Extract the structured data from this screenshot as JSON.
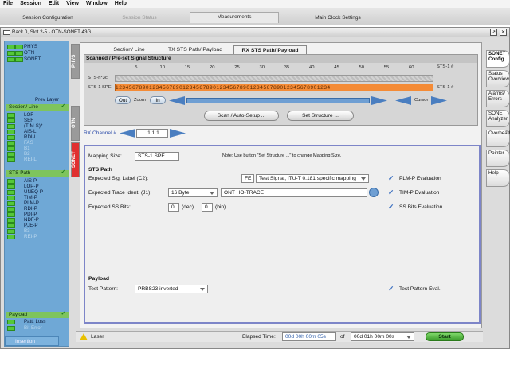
{
  "menu": {
    "file": "File",
    "session": "Session",
    "edit": "Edit",
    "view": "View",
    "window": "Window",
    "help": "Help"
  },
  "tabs": {
    "session_config": "Session Configuration",
    "session_status": "Session Status",
    "measurements": "Measurements",
    "main_clock": "Main Clock Settings"
  },
  "window": {
    "title": "Rack 0, Slot 2-5 - OTN-SONET 43G",
    "restore": "↗",
    "close": "✕"
  },
  "leftpane": {
    "phys": "PHYS",
    "otn": "OTN",
    "sonet": "SONET",
    "prev_layer": "Prev Layer",
    "section_line": "Section/ Line",
    "section_items": [
      "LOF",
      "SEF",
      "(TIM-S)*",
      "AIS-L",
      "RDI-L",
      "FAS",
      "B1",
      "B2",
      "REI-L"
    ],
    "sts_path": "STS Path",
    "path_items": [
      "AIS-P",
      "LOP-P",
      "UNEQ-P",
      "TIM-P",
      "PLM-P",
      "RDI-P",
      "PDI-P",
      "NDF-P",
      "PJE-P",
      "B3",
      "REI-P"
    ],
    "payload": "Payload",
    "patt_loss": "Patt. Loss",
    "bit_error": "Bit Error",
    "insertion": "Insertion"
  },
  "sidetabs": {
    "phys": "PHYS",
    "otn": "OTN",
    "sonet": "SONET"
  },
  "subtabs": {
    "section_line": "Section/ Line",
    "tx_sts": "TX STS Path/ Payload",
    "rx_sts": "RX STS Path/ Payload"
  },
  "signal": {
    "header": "Scanned / Pre-set Signal Structure",
    "ticks": [
      "5",
      "10",
      "15",
      "20",
      "25",
      "30",
      "35",
      "40",
      "45",
      "50",
      "55",
      "60"
    ],
    "row1_label": "STS-n*3c",
    "row2_label": "STS-1 SPE",
    "row_tag": "STS-1 #",
    "row2_digits": "1234567890123456789012345678901234567890123456789012345678901234",
    "out": "Out",
    "zoom": "Zoom",
    "in": "In",
    "cursor": "Cursor"
  },
  "buttons": {
    "scan": "Scan / Auto-Setup ...",
    "set_structure": "Set Structure ...",
    "start": "Start"
  },
  "rx": {
    "label": "RX Channel #",
    "value": "1.1.1"
  },
  "mapping": {
    "label": "Mapping Size:",
    "value": "STS-1 SPE",
    "note": "Note: Use button \"Set Structure ...\" to change Mapping Size."
  },
  "sts_path": {
    "title": "STS Path",
    "sig_label": "Expected Sig. Label (C2):",
    "sig_code": "FE",
    "sig_value": "Test Signal, ITU-T 0.181 specific mapping",
    "trace_label": "Expected Trace Ident. (J1):",
    "trace_len": "16 Byte",
    "trace_value": "ONT HO-TRACE",
    "ss_label": "Expected SS Bits:",
    "ss_dec": "0",
    "ss_dec_unit": "(dec)",
    "ss_bin": "0",
    "ss_bin_unit": "(bin)",
    "plm": "PLM-P Evaluation",
    "tim": "TIM-P Evaluation",
    "ssbits": "SS Bits Evaluation"
  },
  "payload": {
    "title": "Payload",
    "pattern_label": "Test Pattern:",
    "pattern_value": "PRBS23 inverted",
    "pattern_eval": "Test Pattern Eval."
  },
  "righttabs": [
    "SONET Config.",
    "Status Overview",
    "Alarms/ Errors",
    "SONET Analyzer",
    "Overhead",
    "Pointer",
    "Help"
  ],
  "status": {
    "laser": "Laser",
    "elapsed_label": "Elapsed Time:",
    "elapsed": "00d 00h 00m 05s",
    "of": "of",
    "total": "00d 01h 00m 00s"
  },
  "colors": {
    "accent_blue": "#6fa8d6",
    "alarm_green": "#55c838",
    "sts_orange": "#f48b36",
    "tab_red": "#e03030"
  }
}
